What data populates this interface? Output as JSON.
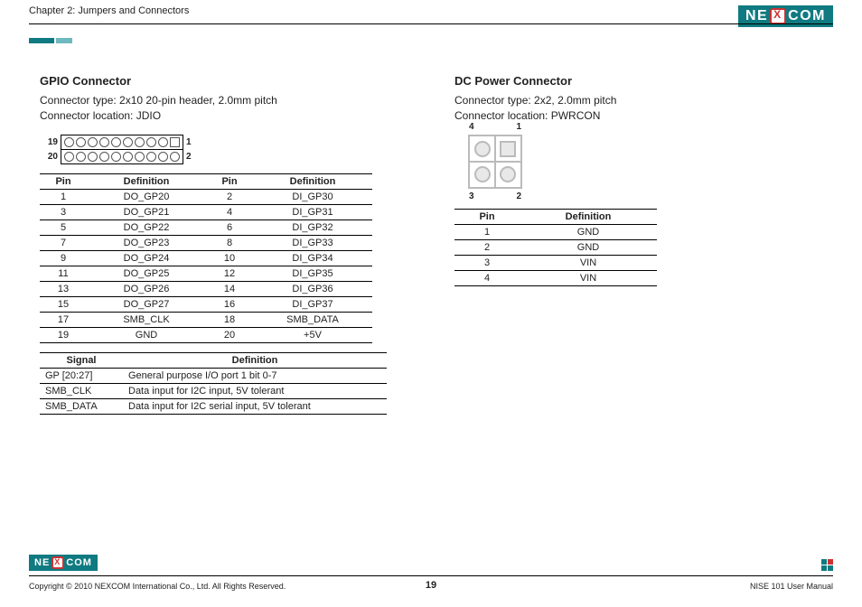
{
  "header": {
    "chapter": "Chapter 2: Jumpers and Connectors",
    "logo_text_1": "NE",
    "logo_text_2": "COM"
  },
  "gpio": {
    "title": "GPIO Connector",
    "type_line": "Connector type: 2x10 20-pin header, 2.0mm pitch",
    "loc_line": "Connector location: JDIO",
    "diagram_labels": {
      "tl": "19",
      "bl": "20",
      "tr": "1",
      "br": "2"
    },
    "pin_header": {
      "pin": "Pin",
      "def": "Definition"
    },
    "pins": [
      {
        "p1": "1",
        "d1": "DO_GP20",
        "p2": "2",
        "d2": "DI_GP30"
      },
      {
        "p1": "3",
        "d1": "DO_GP21",
        "p2": "4",
        "d2": "DI_GP31"
      },
      {
        "p1": "5",
        "d1": "DO_GP22",
        "p2": "6",
        "d2": "DI_GP32"
      },
      {
        "p1": "7",
        "d1": "DO_GP23",
        "p2": "8",
        "d2": "DI_GP33"
      },
      {
        "p1": "9",
        "d1": "DO_GP24",
        "p2": "10",
        "d2": "DI_GP34"
      },
      {
        "p1": "11",
        "d1": "DO_GP25",
        "p2": "12",
        "d2": "DI_GP35"
      },
      {
        "p1": "13",
        "d1": "DO_GP26",
        "p2": "14",
        "d2": "DI_GP36"
      },
      {
        "p1": "15",
        "d1": "DO_GP27",
        "p2": "16",
        "d2": "DI_GP37"
      },
      {
        "p1": "17",
        "d1": "SMB_CLK",
        "p2": "18",
        "d2": "SMB_DATA"
      },
      {
        "p1": "19",
        "d1": "GND",
        "p2": "20",
        "d2": "+5V"
      }
    ],
    "sig_header": {
      "sig": "Signal",
      "def": "Definition"
    },
    "signals": [
      {
        "s": "GP [20:27]",
        "d": "General purpose I/O port 1 bit 0-7"
      },
      {
        "s": "SMB_CLK",
        "d": "Data input for I2C input, 5V tolerant"
      },
      {
        "s": "SMB_DATA",
        "d": "Data input for I2C serial input, 5V tolerant"
      }
    ]
  },
  "pwr": {
    "title": "DC Power Connector",
    "type_line": "Connector type: 2x2, 2.0mm pitch",
    "loc_line": "Connector location: PWRCON",
    "diagram_labels": {
      "tl": "4",
      "tr": "1",
      "bl": "3",
      "br": "2"
    },
    "pin_header": {
      "pin": "Pin",
      "def": "Definition"
    },
    "pins": [
      {
        "p": "1",
        "d": "GND"
      },
      {
        "p": "2",
        "d": "GND"
      },
      {
        "p": "3",
        "d": "VIN"
      },
      {
        "p": "4",
        "d": "VIN"
      }
    ]
  },
  "footer": {
    "copyright": "Copyright © 2010 NEXCOM International Co., Ltd. All Rights Reserved.",
    "page": "19",
    "manual": "NISE 101 User Manual"
  }
}
